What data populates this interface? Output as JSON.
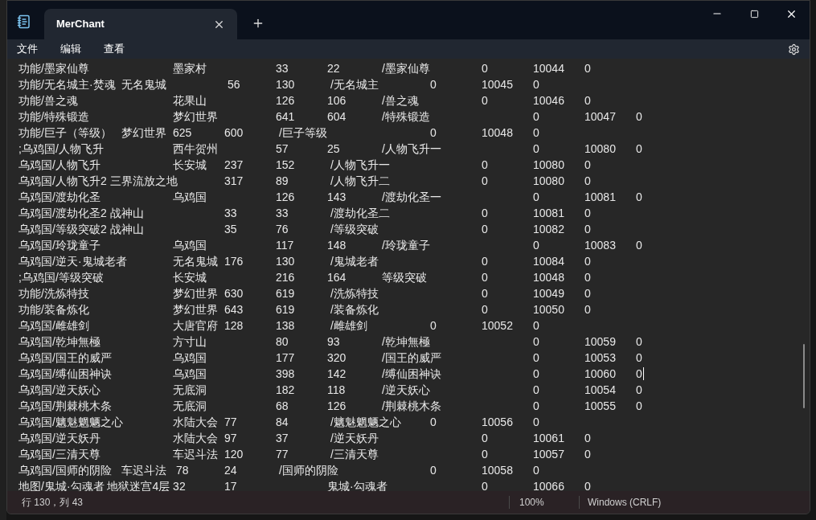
{
  "window": {
    "tab_title": "MerChant"
  },
  "menu": [
    "文件",
    "编辑",
    "查看"
  ],
  "editor": {
    "lines": [
      {
        "text": "功能/墨家仙尊\t\t墨家村\t\t33\t22\t /墨家仙尊\t0\t10044\t0",
        "has_caret": false
      },
      {
        "text": "功能/无名城主·焚魂\t无名鬼城\t\t 56\t130\t /无名城主\t0\t10045\t0",
        "has_caret": false
      },
      {
        "text": "功能/兽之魂\t\t花果山\t\t126\t106\t /兽之魂\t\t0\t10046\t0",
        "has_caret": false
      },
      {
        "text": "功能/特殊锻造\t\t梦幻世界\t\t641\t604\t /特殊锻造\t\t0\t10047\t0",
        "has_caret": false
      },
      {
        "text": "功能/巨子（等级）\t梦幻世界\t625\t600\t /巨子等级\t\t0\t10048\t0",
        "has_caret": false
      },
      {
        "text": ";乌鸡国/人物飞升\t\t西牛贺州\t\t57\t25\t /人物飞升一\t\t0\t10080\t0",
        "has_caret": false
      },
      {
        "text": "乌鸡国/人物飞升\t\t长安城\t237\t152\t /人物飞升一\t\t0\t10080\t0",
        "has_caret": false
      },
      {
        "text": "乌鸡国/人物飞升2 三界流放之地\t317\t89\t /人物飞升二\t\t0\t10080\t0",
        "has_caret": false
      },
      {
        "text": "乌鸡国/渡劫化圣\t\t乌鸡国\t\t126\t143\t /渡劫化圣一\t\t0\t10081\t0",
        "has_caret": false
      },
      {
        "text": "乌鸡国/渡劫化圣2 战神山\t\t33\t33\t /渡劫化圣二\t\t0\t10081\t0",
        "has_caret": false
      },
      {
        "text": "乌鸡国/等级突破2 战神山\t\t35\t76\t /等级突破\t\t0\t10082\t0",
        "has_caret": false
      },
      {
        "text": "乌鸡国/玲珑童子\t\t乌鸡国\t\t117\t148\t /玲珑童子\t\t0\t10083\t0",
        "has_caret": false
      },
      {
        "text": "乌鸡国/逆天·鬼城老者\t无名鬼城\t176\t130\t /鬼城老者\t\t0\t10084\t0",
        "has_caret": false
      },
      {
        "text": ";乌鸡国/等级突破\t\t长安城\t\t216\t164\t 等级突破\t\t0\t10048\t0",
        "has_caret": false
      },
      {
        "text": "功能/洗炼特技\t\t梦幻世界\t630\t619\t /洗炼特技\t\t0\t10049\t0",
        "has_caret": false
      },
      {
        "text": "功能/装备炼化\t\t梦幻世界\t643\t619\t /装备炼化\t\t0\t10050\t0",
        "has_caret": false
      },
      {
        "text": "乌鸡国/雌雄剑\t\t大唐官府\t128\t138\t /雌雄剑\t\t0\t10052\t0",
        "has_caret": false
      },
      {
        "text": "乌鸡国/乾坤無極\t\t方寸山\t\t80\t93\t /乾坤無極\t\t0\t10059\t0",
        "has_caret": false
      },
      {
        "text": "乌鸡国/国王的威严\t\t乌鸡国\t\t177\t320\t /国王的威严\t\t0\t10053\t0",
        "has_caret": false
      },
      {
        "text": "乌鸡国/缚仙困神诀\t\t乌鸡国\t\t398\t142\t /缚仙困神诀\t\t0\t10060\t0",
        "has_caret": true
      },
      {
        "text": "乌鸡国/逆天妖心\t\t无底洞\t\t182\t118\t /逆天妖心\t\t0\t10054\t0",
        "has_caret": false
      },
      {
        "text": "乌鸡国/荆棘桃木条\t\t无底洞\t\t68\t126\t /荆棘桃木条\t\t0\t10055\t0",
        "has_caret": false
      },
      {
        "text": "乌鸡国/魑魅魍魉之心\t水陆大会\t77\t84\t /魑魅魍魉之心\t0\t10056\t0",
        "has_caret": false
      },
      {
        "text": "乌鸡国/逆天妖丹\t\t水陆大会\t97\t37\t /逆天妖丹\t\t0\t10061\t0",
        "has_caret": false
      },
      {
        "text": "乌鸡国/三清天尊\t\t车迟斗法\t120\t77\t /三清天尊\t\t0\t10057\t0",
        "has_caret": false
      },
      {
        "text": "乌鸡国/国师的阴险\t车迟斗法\t 78\t24\t /国师的阴险\t\t0\t10058\t0",
        "has_caret": false
      },
      {
        "text": "地图/鬼城·勾魂者 地狱迷宫4层 32\t17\t\t鬼城·勾魂者\t\t0\t10066\t0",
        "has_caret": false
      }
    ]
  },
  "status_bar": {
    "position": "行 130，列 43",
    "zoom": "100%",
    "line_ending": "Windows (CRLF)"
  }
}
